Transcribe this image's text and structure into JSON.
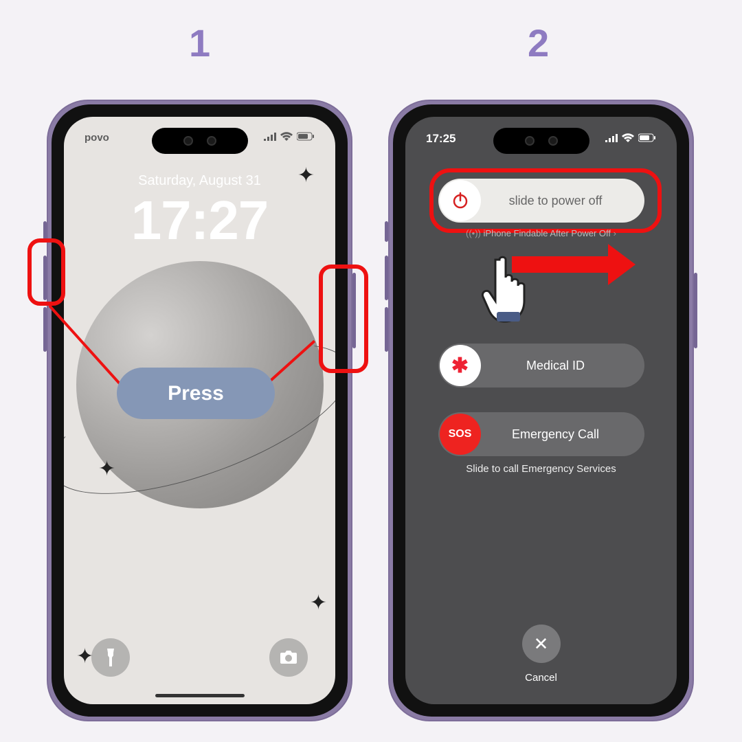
{
  "steps": {
    "one": "1",
    "two": "2"
  },
  "colors": {
    "accent_red": "#ee1111",
    "step_purple": "#8e7bc1"
  },
  "lockscreen": {
    "carrier": "povo",
    "date": "Saturday, August 31",
    "time": "17:27",
    "flashlight_icon": "flashlight",
    "camera_icon": "camera"
  },
  "annotation": {
    "press_label": "Press"
  },
  "poweroff": {
    "status_time": "17:25",
    "slide_power": "slide to power off",
    "findable": "iPhone Findable After Power Off",
    "medical_id": "Medical ID",
    "emergency_call": "Emergency Call",
    "sos_label": "SOS",
    "asterisk": "✱",
    "sos_hint": "Slide to call Emergency Services",
    "cancel": "Cancel"
  }
}
